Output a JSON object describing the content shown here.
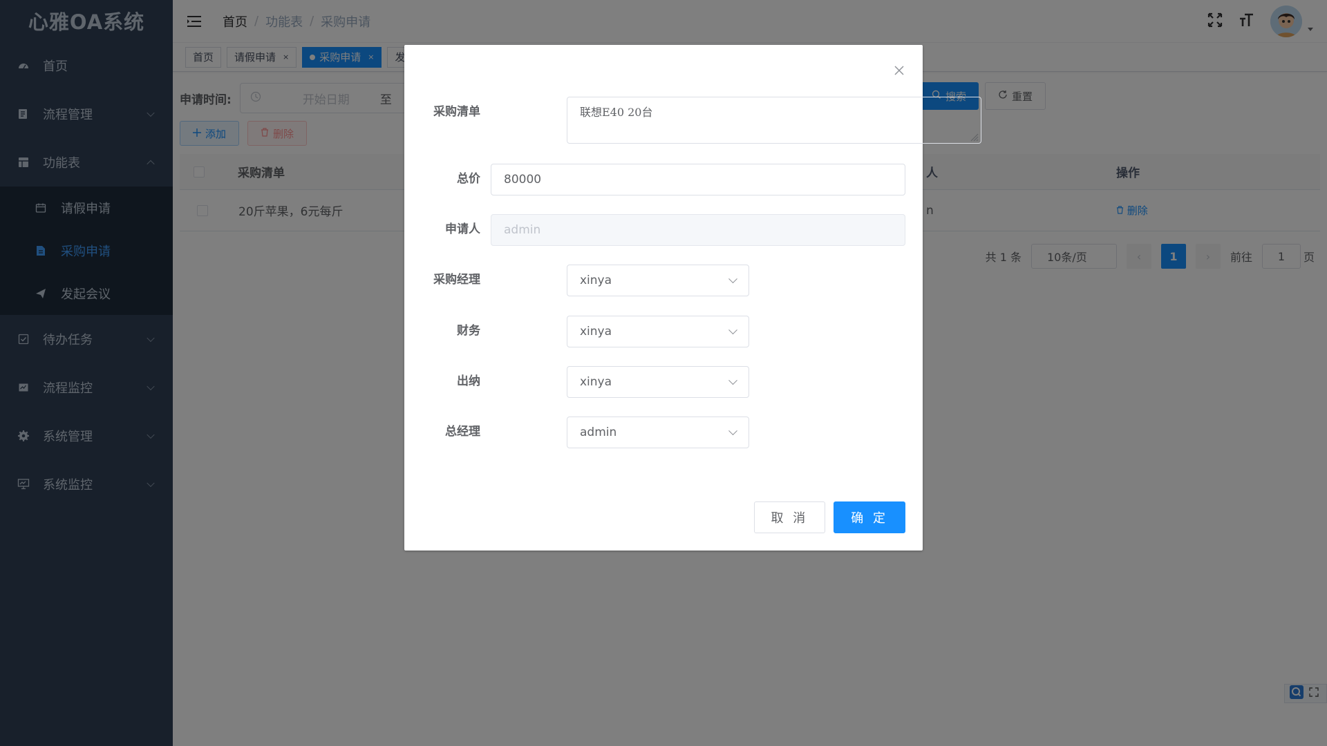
{
  "app": {
    "title": "心雅OA系统"
  },
  "sidebar": {
    "items": [
      {
        "label": "首页",
        "icon": "dashboard-icon"
      },
      {
        "label": "流程管理",
        "icon": "process-icon"
      },
      {
        "label": "功能表",
        "icon": "table-icon"
      },
      {
        "label": "待办任务",
        "icon": "checkbox-icon"
      },
      {
        "label": "流程监控",
        "icon": "monitor-icon"
      },
      {
        "label": "系统管理",
        "icon": "gear-icon"
      },
      {
        "label": "系统监控",
        "icon": "screen-icon"
      }
    ],
    "submenu": [
      {
        "label": "请假申请",
        "icon": "calendar-icon"
      },
      {
        "label": "采购申请",
        "icon": "document-icon",
        "active": true
      },
      {
        "label": "发起会议",
        "icon": "send-icon"
      }
    ]
  },
  "breadcrumb": {
    "home": "首页",
    "level1": "功能表",
    "level2": "采购申请"
  },
  "tags": [
    {
      "label": "首页"
    },
    {
      "label": "请假申请",
      "close": "×"
    },
    {
      "label": "采购申请",
      "close": "×",
      "active": true
    },
    {
      "label": "发"
    }
  ],
  "search": {
    "label": "申请时间:",
    "start_placeholder": "开始日期",
    "range_sep": "至",
    "search_label": "搜索",
    "reset_label": "重置"
  },
  "toolbar": {
    "add_label": "添加",
    "delete_label": "删除"
  },
  "table": {
    "headers": {
      "list": "采购清单",
      "mid": "人",
      "op": "操作"
    },
    "rows": [
      {
        "list": "20斤苹果，6元每斤",
        "mid": "n",
        "op": "删除"
      }
    ]
  },
  "pagination": {
    "total": "共 1 条",
    "page_size": "10条/页",
    "current": "1",
    "goto_label": "前往",
    "goto_value": "1",
    "page_suffix": "页"
  },
  "dialog": {
    "fields": {
      "list_label": "采购清单",
      "list_value": "联想E40 20台",
      "price_label": "总价",
      "price_value": "80000",
      "applicant_label": "申请人",
      "applicant_placeholder": "admin",
      "manager_label": "采购经理",
      "manager_value": "xinya",
      "finance_label": "财务",
      "finance_value": "xinya",
      "cashier_label": "出纳",
      "cashier_value": "xinya",
      "gm_label": "总经理",
      "gm_value": "admin"
    },
    "cancel_label": "取 消",
    "ok_label": "确 定"
  },
  "colors": {
    "sidebar_bg": "#304156",
    "primary": "#1890ff",
    "active_text": "#409eff"
  }
}
